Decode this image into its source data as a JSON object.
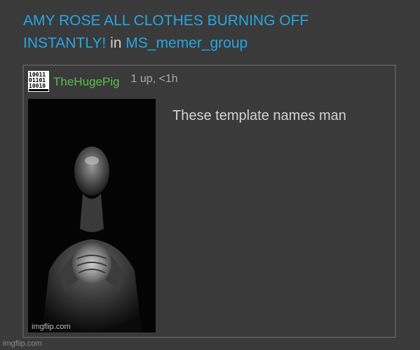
{
  "post": {
    "title_line1": "AMY ROSE ALL CLOTHES BURNING OFF",
    "title_line2": "INSTANTLY!",
    "in_word": "in",
    "stream": "MS_memer_group"
  },
  "comment": {
    "username": "TheHugePig",
    "meta": "1 up, <1h",
    "text": "These template names man",
    "image_icon": "praying-man-meme-image",
    "avatar_icon": "binary-digits-avatar",
    "image_watermark": "imgflip.com"
  },
  "footer": {
    "watermark": "imgflip.com"
  },
  "colors": {
    "background": "#3a3a3b",
    "link": "#24a7e4",
    "username": "#58c04a",
    "border": "#575757"
  }
}
